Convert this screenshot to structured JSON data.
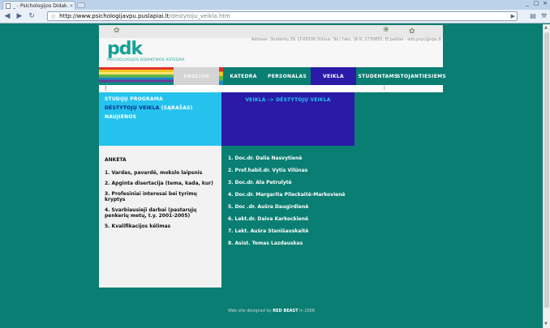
{
  "browser": {
    "tab_title": "_ - Psichologijos Didak...",
    "tab_close": "×",
    "url_host": "http://www.psichologijavpu.puslapiai.lt",
    "url_path": "/destytoju_veikla.htm",
    "window_buttons": [
      "_",
      "□",
      "×"
    ]
  },
  "header": {
    "logo_mark": "pdk",
    "logo_sub": "PSICHOLOGIJOS DIDAKTIKOS KATEDRA",
    "address": "Adresas: Studentų 39, LT-08106 Vilnius. Tel./ faks. (8-5) 2730855. El.paštas - edu.psyc@vpu.lt"
  },
  "nav": {
    "english": "ENGLISH",
    "katedra": "KATEDRA",
    "personalas": "PERSONALAS",
    "veikla": "VEIKLA",
    "studentams": "STUDENTAMS",
    "stojantiesiems": "STOJANTIESIEMS"
  },
  "left_menu": {
    "studiju_programa": "STUDIJŲ PROGRAMA",
    "destytoju_veikla": "DĖSTYTOJŲ VEIKLA",
    "sarasas": "(SĄRAŠAS)",
    "naujienos": "NAUJIENOS"
  },
  "breadcrumb": "VEIKLA -> DĖSTYTOJŲ VEIKLA",
  "anketa": {
    "title": "ANKETA",
    "items": [
      "1. Vardas, pavardė, mokslo laipsnis",
      "2. Apginta disertacija (tema, kada, kur)",
      "3. Profesiniai interesai bei tyrimų kryptys",
      "4. Svarbiausieji darbai (pastarųjų penkerių metų, t.y. 2001-2005)",
      "5. Kvalifikacijos kėlimas"
    ]
  },
  "staff": [
    "1. Doc.dr. Dalia Nasvytienė",
    "2. Prof.habil.dr. Vytis Vilūnas",
    "3. Doc.dr. Ala Petrulytė",
    "4. Doc.dr. Margarita Pileckaitė-Markovienė",
    "5. Doc .dr. Aušra Daugirdienė",
    "6. Lekt.dr. Daiva Karkockienė",
    "7. Lekt. Aušra Stanišauskaitė",
    "8. Asist. Tomas Lazdauskas"
  ],
  "footer": {
    "prefix": "Web site designed by",
    "brand": "RED BEAST",
    "suffix": "in 2006"
  }
}
